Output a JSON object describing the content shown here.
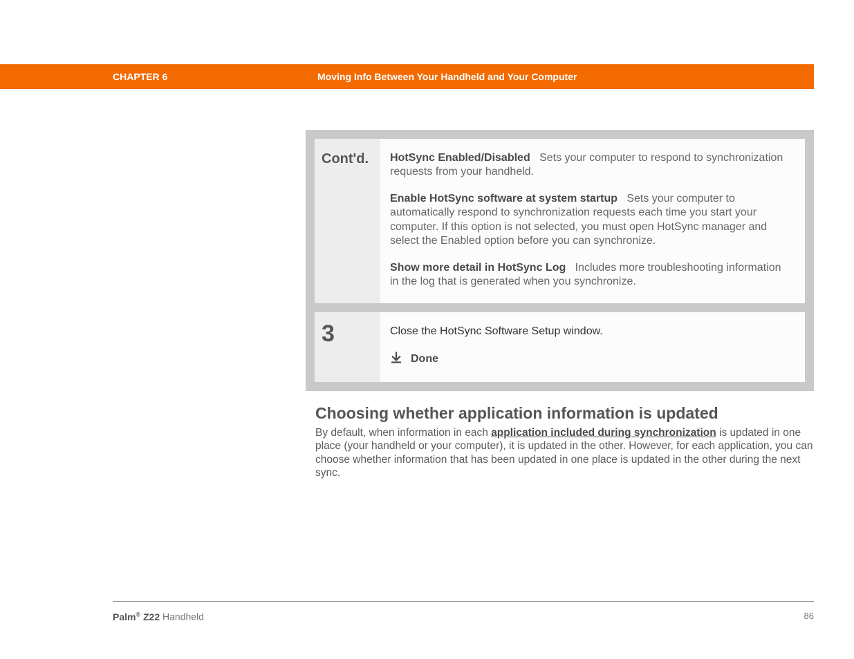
{
  "header": {
    "chapter": "CHAPTER 6",
    "title": "Moving Info Between Your Handheld and Your Computer"
  },
  "steps": {
    "contd": {
      "label": "Cont'd.",
      "opt1_title": "HotSync Enabled/Disabled",
      "opt1_desc": "Sets your computer to respond to synchronization requests from your handheld.",
      "opt2_title": "Enable HotSync software at system startup",
      "opt2_desc": "Sets your computer to automatically respond to synchronization requests each time you start your computer. If this option is not selected, you must open HotSync manager and select the Enabled option before you can synchronize.",
      "opt3_title": "Show more detail in HotSync Log",
      "opt3_desc": "Includes more troubleshooting information in the log that is generated when you synchronize."
    },
    "step3": {
      "label": "3",
      "text": "Close the HotSync Software Setup window.",
      "done": "Done"
    }
  },
  "section": {
    "heading": "Choosing whether application information is updated",
    "intro_a": "By default, when information in each ",
    "link": "application included during synchronization",
    "intro_b": " is updated in one place (your handheld or your computer), it is updated in the other. However, for each application, you can choose whether information that has been updated in one place is updated in the other during the next sync."
  },
  "footer": {
    "product_a": "Palm",
    "product_reg": "®",
    "product_b": " Z22",
    "product_tail": " Handheld",
    "page": "86"
  }
}
